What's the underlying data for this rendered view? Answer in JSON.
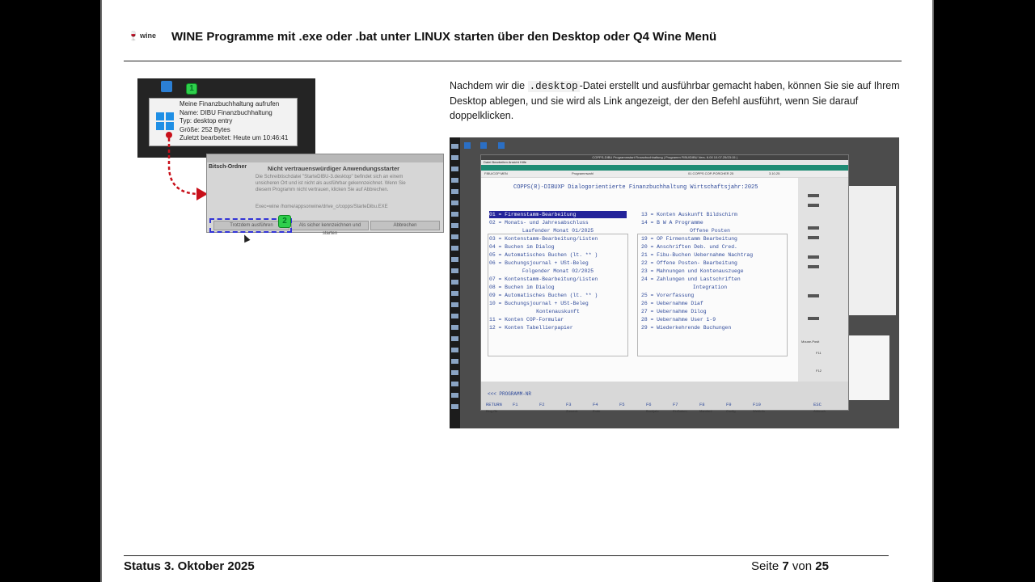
{
  "header": {
    "logo_text": "wine",
    "title": "WINE Programme mit .exe oder .bat unter LINUX starten über den Desktop oder Q4 Wine Menü"
  },
  "paragraph": {
    "before": "Nachdem wir die ",
    "code": ".desktop",
    "after": "-Datei erstellt und ausführbar gemacht haben, können Sie sie auf Ihrem Desktop ablegen, und sie wird als Link angezeigt, der den Befehl ausführt, wenn Sie darauf doppelklicken."
  },
  "screenshot_left": {
    "badge1": "1",
    "badge2": "2",
    "tooltip": [
      "Meine Finanzbuchhaltung aufrufen",
      "Name: DIBU Finanzbuchhaltung",
      "Typ: desktop entry",
      "Größe: 252 Bytes",
      "Zuletzt bearbeitet: Heute um 10:46:41"
    ],
    "dialog_side_label": "Bitsch-Ordner",
    "dialog_title": "Nicht vertrauenswürdiger Anwendungsstarter",
    "dialog_body": "Die Schreibtischdatei \"StarteDIBU-3.desktop\" befindet sich an einem unsicheren Ort und ist nicht als ausführbar gekennzeichnet. Wenn Sie diesem Programm nicht vertrauen, klicken Sie auf Abbrechen.",
    "dialog_exec": "Exec=wine /home/appsonwine/drive_c/copps/StarteDibu.EXE",
    "btn_trust": "Trotzdem ausführen",
    "btn_mark": "Als sicher kennzeichnen und starten",
    "btn_cancel": "Abbrechen"
  },
  "screenshot_right": {
    "window_title": "COPPS-DIBU Programmstart Finanzbuchhaltung | Programm FIBU/DIBU Vers. 6.00 10.07.25/23:15 |",
    "menu": "Datei  Bearbeiten  Ansicht  Hilfe",
    "infobar": [
      "FIBU/COP MEN",
      "Programmwahl",
      "01 COPPS COP-PORCHER 25",
      "3.10.25"
    ],
    "main_title": "COPPS(R)-DIBUXP Dialogorientierte Finanzbuchhaltung  Wirtschaftsjahr:2025",
    "left_col": [
      "01 = Firmenstamm-Bearbeitung",
      "02 = Monats- und Jahresabschluss",
      "Laufender Monat 01/2025",
      "03 = Kontenstamm-Bearbeitung/Listen",
      "04 = Buchen im Dialog",
      "05 = Automatisches Buchen (lt. ** )",
      "06 = Buchungsjournal + USt-Beleg",
      "Folgender Monat 02/2025",
      "07 = Kontenstamm-Bearbeitung/Listen",
      "08 = Buchen im Dialog",
      "09 = Automatisches Buchen (lt. ** )",
      "10 = Buchungsjournal + USt-Beleg",
      "Kontenauskunft",
      "11 = Konten COP-Formular",
      "12 = Konten Tabellierpapier"
    ],
    "right_col": [
      "13 = Konten Auskunft Bildschirm",
      "14 = B W A Programme",
      "Offene Posten",
      "19 = OP Firmenstamm Bearbeitung",
      "20 = Anschriften Deb. und Cred.",
      "21 = Fibu-Buchen Uebernahme Nachtrag",
      "22 = Offene Posten- Bearbeitung",
      "23 = Mahnungen und Kontenauszuege",
      "24 = Zahlungen und Lastschriften",
      "Integration",
      "25 = Vorerfassung",
      "26 = Uebernahme Diaf",
      "27 = Uebernahme Dilog",
      "28 = Uebernahme User 1-9",
      "29 = Wiederkehrende Buchungen"
    ],
    "prompt": "<<< PROGRAMM-NR",
    "fkeys": [
      "RETURN",
      "F1",
      "F2",
      "F3",
      "F4",
      "F5",
      "F6",
      "F7",
      "F8",
      "F9",
      "F10",
      "ESC"
    ],
    "fkey_subs": [
      "Eing.Ok",
      "",
      "",
      "Zurueck",
      "Ende",
      "",
      "Buchjahr",
      "EinDatum",
      "Mandant",
      "Config",
      "WebInfo",
      "Abbruch"
    ],
    "side_labels": [
      "Mouse-Posit",
      "F11",
      "F12"
    ]
  },
  "footer": {
    "status": "Status 3. Oktober 2025",
    "page_prefix": "Seite ",
    "page_num": "7",
    "page_mid": " von ",
    "page_total": "25"
  }
}
